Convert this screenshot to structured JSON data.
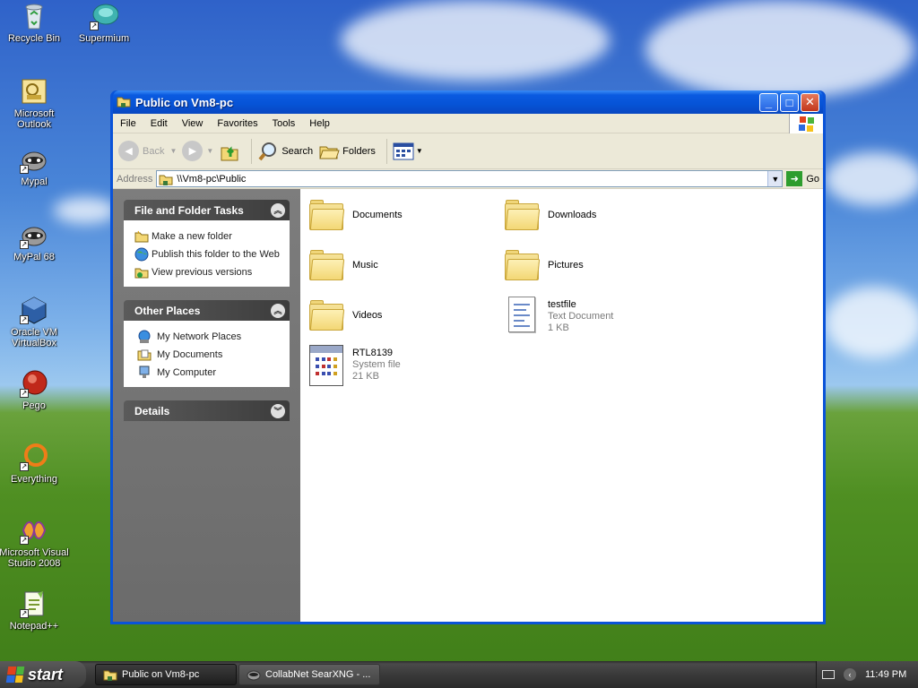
{
  "desktop": {
    "icons": [
      {
        "label": "Recycle Bin",
        "icon": "recycle-bin-icon"
      },
      {
        "label": "Supermium",
        "icon": "supermium-icon"
      },
      {
        "label": "Microsoft Outlook",
        "icon": "outlook-icon"
      },
      {
        "label": "Mypal",
        "icon": "mypal-icon"
      },
      {
        "label": "MyPal 68",
        "icon": "mypal-68-icon"
      },
      {
        "label": "Oracle VM VirtualBox",
        "icon": "virtualbox-icon"
      },
      {
        "label": "Pego",
        "icon": "pego-icon"
      },
      {
        "label": "Everything",
        "icon": "everything-icon"
      },
      {
        "label": "Microsoft Visual Studio 2008",
        "icon": "visual-studio-icon"
      },
      {
        "label": "Notepad++",
        "icon": "notepad-plus-plus-icon"
      }
    ]
  },
  "window": {
    "title": "Public on Vm8-pc",
    "menu": [
      "File",
      "Edit",
      "View",
      "Favorites",
      "Tools",
      "Help"
    ],
    "toolbar": {
      "back": "Back",
      "search": "Search",
      "folders": "Folders"
    },
    "address": {
      "label": "Address",
      "value": "\\\\Vm8-pc\\Public",
      "go": "Go"
    },
    "taskpane": {
      "file_tasks": {
        "title": "File and Folder Tasks",
        "items": [
          "Make a new folder",
          "Publish this folder to the Web",
          "View previous versions"
        ]
      },
      "other_places": {
        "title": "Other Places",
        "items": [
          "My Network Places",
          "My Documents",
          "My Computer"
        ]
      },
      "details": {
        "title": "Details"
      }
    },
    "items": [
      {
        "name": "Documents",
        "type": "folder"
      },
      {
        "name": "Downloads",
        "type": "folder"
      },
      {
        "name": "Music",
        "type": "folder"
      },
      {
        "name": "Pictures",
        "type": "folder"
      },
      {
        "name": "Videos",
        "type": "folder"
      },
      {
        "name": "testfile",
        "type": "Text Document",
        "size": "1 KB"
      },
      {
        "name": "RTL8139",
        "type": "System file",
        "size": "21 KB"
      }
    ]
  },
  "taskbar": {
    "start": "start",
    "buttons": [
      {
        "label": "Public on Vm8-pc",
        "active": true
      },
      {
        "label": "CollabNet SearXNG - ...",
        "active": false
      }
    ],
    "clock": "11:49 PM"
  },
  "colors": {
    "title_blue": "#0a53d8",
    "taskpane_gray": "#6b6b6b",
    "folder_yellow": "#f3d775"
  }
}
